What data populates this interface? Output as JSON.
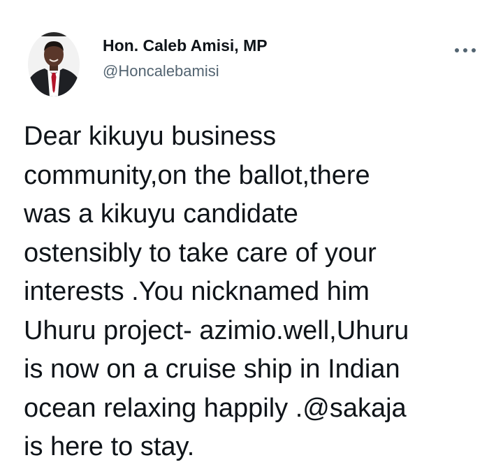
{
  "author": {
    "display_name": "Hon. Caleb Amisi, MP",
    "handle": "@Honcalebamisi",
    "avatar_icon": "profile-photo"
  },
  "more_icon": "more-options-icon",
  "tweet": {
    "lines": [
      "Dear kikuyu business",
      "community,on the ballot,there",
      "was a kikuyu candidate",
      "ostensibly to take care of your",
      "interests .You nicknamed him",
      "Uhuru project- azimio.well,Uhuru",
      "is now on a cruise ship in Indian",
      "ocean relaxing happily .@sakaja",
      "is here to stay."
    ]
  },
  "colors": {
    "text_primary": "#0f1419",
    "text_secondary": "#536471",
    "background": "#ffffff"
  }
}
